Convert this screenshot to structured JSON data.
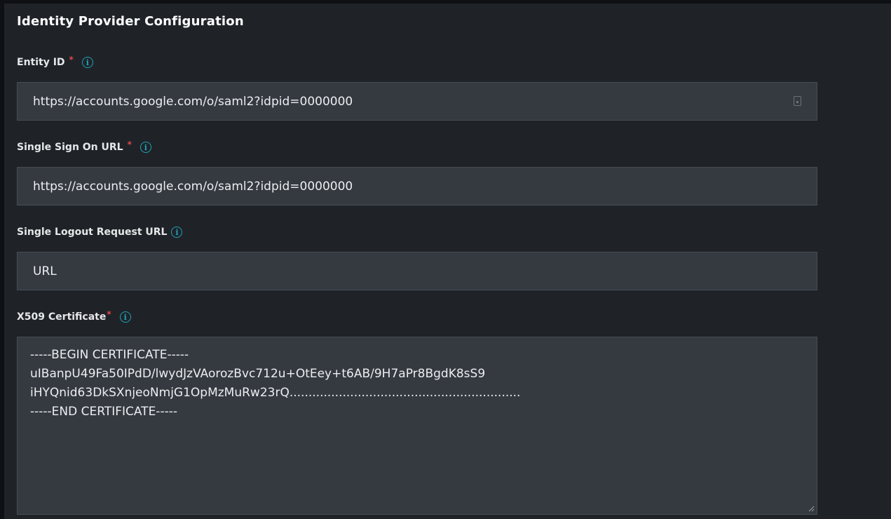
{
  "section": {
    "title": "Identity Provider Configuration"
  },
  "fields": {
    "entity_id": {
      "label": "Entity ID",
      "required_mark": "*",
      "value": "https://accounts.google.com/o/saml2?idpid=0000000",
      "icon": "info-icon",
      "trailing_icon": "contact-card-icon"
    },
    "sso_url": {
      "label": "Single Sign On URL",
      "required_mark": "*",
      "value": "https://accounts.google.com/o/saml2?idpid=0000000",
      "icon": "info-icon"
    },
    "logout_url": {
      "label": "Single Logout Request URL",
      "placeholder": "URL",
      "icon": "info-icon"
    },
    "certificate": {
      "label": "X509 Certificate",
      "required_mark": "*",
      "icon": "info-icon",
      "lines": [
        "-----BEGIN CERTIFICATE-----",
        "uIBanpU49Fa50IPdD/lwydJzVAorozBvc712u+OtEey+t6AB/9H7aPr8BgdK8sS9",
        "iHYQnid63DkSXnjeoNmjG1OpMzMuRw23rQ.............................................................",
        "-----END CERTIFICATE-----"
      ]
    }
  },
  "colors": {
    "background": "#1f2328",
    "input_bg": "#353a41",
    "required": "#e0474c",
    "info_icon": "#1fa2b4"
  }
}
